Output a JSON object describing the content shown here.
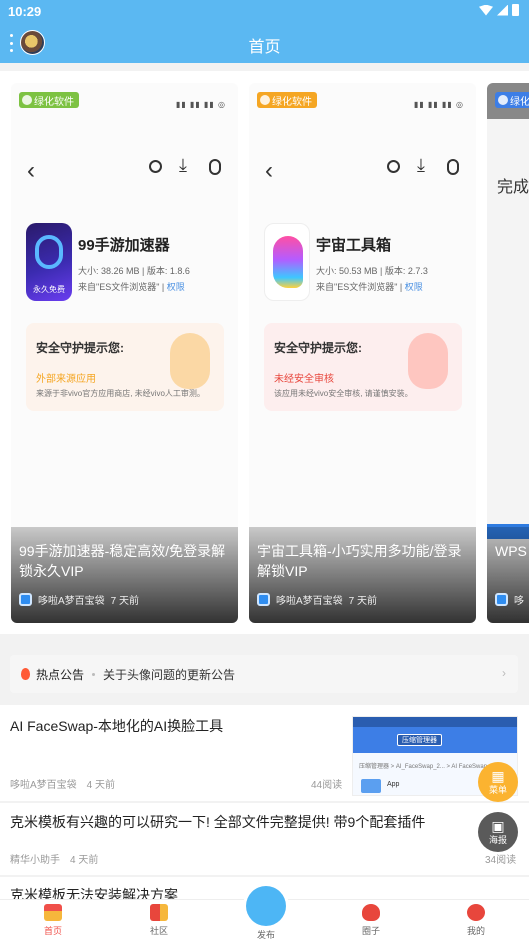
{
  "status": {
    "time": "10:29"
  },
  "header": {
    "title": "首页"
  },
  "carousel": {
    "cards": [
      {
        "tag": "绿化软件",
        "app_name": "99手游加速器",
        "size": "大小: 38.26 MB",
        "version": "版本: 1.8.6",
        "source": "来自\"ES文件浏览器\"",
        "perm": "权限",
        "icon_label": "永久免费",
        "safe_title": "安全守护提示您:",
        "safe_warn": "外部来源应用",
        "safe_desc": "来源于非vivo官方应用商店, 未经vivo人工审测。",
        "title": "99手游加速器-稳定高效/免登录解锁永久VIP",
        "author": "哆啦A梦百宝袋",
        "time": "7 天前"
      },
      {
        "tag": "绿化软件",
        "app_name": "宇宙工具箱",
        "size": "大小: 50.53 MB",
        "version": "版本: 2.7.3",
        "source": "来自\"ES文件浏览器\"",
        "perm": "权限",
        "safe_title": "安全守护提示您:",
        "safe_warn": "未经安全审核",
        "safe_desc": "该应用未经vivo安全审核, 请谨慎安装。",
        "title": "宇宙工具箱-小巧实用多功能/登录解锁VIP",
        "author": "哆啦A梦百宝袋",
        "time": "7 天前"
      },
      {
        "tag": "绿化软件",
        "screen_word": "完成",
        "title": "WPS 锁高级",
        "author": "哆"
      }
    ]
  },
  "notice": {
    "label": "热点公告",
    "text": "关于头像问题的更新公告"
  },
  "feed": [
    {
      "title": "AI FaceSwap-本地化的AI换脸工具",
      "author": "哆啦A梦百宝袋",
      "time": "4 天前",
      "reads": "44阅读",
      "thumb_chip": "压缩管理器",
      "thumb_path": "压缩管理器 > AI_FaceSwap_2... > AI FaceSwap...",
      "thumb_app": "App"
    },
    {
      "title": "克米模板有兴趣的可以研究一下! 全部文件完整提供! 带9个配套插件",
      "author": "精华小助手",
      "time": "4 天前",
      "reads": "34阅读"
    },
    {
      "title": "克米模板无法安装解决方案"
    }
  ],
  "fabs": {
    "menu": "菜单",
    "poster": "海报"
  },
  "nav": {
    "home": "首页",
    "community": "社区",
    "publish": "发布",
    "circle": "圈子",
    "mine": "我的"
  },
  "colors": {
    "primary": "#5bb8f2",
    "accent_red": "#f0504a",
    "tag_green": "#7dc242",
    "tag_orange": "#f5a623",
    "fab_orange": "#fbb330",
    "fab_gray": "#5a5a5a"
  }
}
